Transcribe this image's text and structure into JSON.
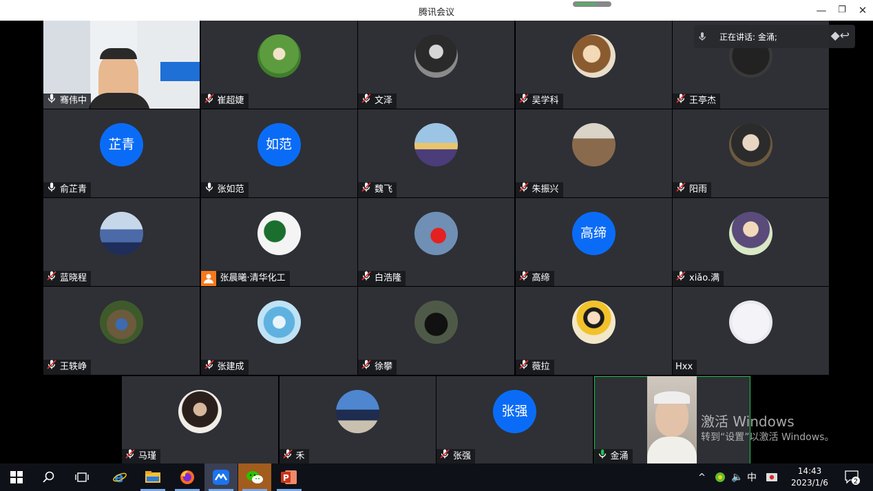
{
  "window": {
    "title": "腾讯会议",
    "minimize_glyph": "—",
    "restore_glyph": "❐",
    "close_glyph": "✕"
  },
  "speaking": {
    "label": "正在讲话: 金涌;"
  },
  "participants": [
    {
      "name": "骞伟中",
      "mic": "on",
      "avatar": "video-office"
    },
    {
      "name": "崔超婕",
      "mic": "muted",
      "avatar": "photo-child"
    },
    {
      "name": "文泽",
      "mic": "muted",
      "avatar": "photo-portrait-bw"
    },
    {
      "name": "吴学科",
      "mic": "muted",
      "avatar": "photo-anime-violin"
    },
    {
      "name": "王亭杰",
      "mic": "muted",
      "avatar": "photo-dark"
    },
    {
      "name": "俞芷青",
      "mic": "on",
      "avatar_text": "芷青"
    },
    {
      "name": "张如范",
      "mic": "on",
      "avatar_text": "如范"
    },
    {
      "name": "魏飞",
      "mic": "muted",
      "avatar": "photo-castle"
    },
    {
      "name": "朱振兴",
      "mic": "muted",
      "avatar": "photo-city"
    },
    {
      "name": "阳雨",
      "mic": "muted",
      "avatar": "photo-gauss"
    },
    {
      "name": "蓝晓程",
      "mic": "muted",
      "avatar": "photo-mountain"
    },
    {
      "name": "张晨曦·清华化工",
      "mic": "host",
      "avatar": "photo-watermelon"
    },
    {
      "name": "白浩隆",
      "mic": "muted",
      "avatar": "photo-ant"
    },
    {
      "name": "高缔",
      "mic": "muted",
      "avatar_text": "高缔"
    },
    {
      "name": "xiǎo.满",
      "mic": "muted",
      "avatar": "photo-anime-girl"
    },
    {
      "name": "王轶峥",
      "mic": "muted",
      "avatar": "photo-park"
    },
    {
      "name": "张建成",
      "mic": "muted",
      "avatar": "photo-knot"
    },
    {
      "name": "徐攀",
      "mic": "muted",
      "avatar": "photo-hand-watch"
    },
    {
      "name": "薇拉",
      "mic": "muted",
      "avatar": "photo-snowwhite"
    },
    {
      "name": "Hxx",
      "mic": "none",
      "avatar": "photo-sketch"
    },
    {
      "name": "马瑾",
      "mic": "muted",
      "avatar": "photo-woman"
    },
    {
      "name": "禾",
      "mic": "muted",
      "avatar": "photo-temple"
    },
    {
      "name": "张强",
      "mic": "muted",
      "avatar_text": "张强"
    },
    {
      "name": "金涌",
      "mic": "speaking",
      "avatar": "video-elder"
    }
  ],
  "watermark": {
    "line1": "激活 Windows",
    "line2": "转到“设置”以激活 Windows。"
  },
  "taskbar": {
    "apps": [
      "windows-start-icon",
      "search-icon",
      "task-view-icon",
      "ie-browser-icon",
      "file-explorer-icon",
      "firefox-icon",
      "tencent-meeting-icon",
      "wechat-icon",
      "powerpoint-icon"
    ],
    "tray": {
      "chevron": "^",
      "ime": "中",
      "volume": "🔈",
      "time": "14:43",
      "date": "2023/1/6",
      "notifications": "2"
    }
  },
  "colors": {
    "tile_bg": "#2e3035",
    "avatar_blue": "#0a6cf6",
    "speaking_green": "#1fc44e",
    "muted_red": "#e5322d",
    "host_orange": "#f7781b"
  }
}
